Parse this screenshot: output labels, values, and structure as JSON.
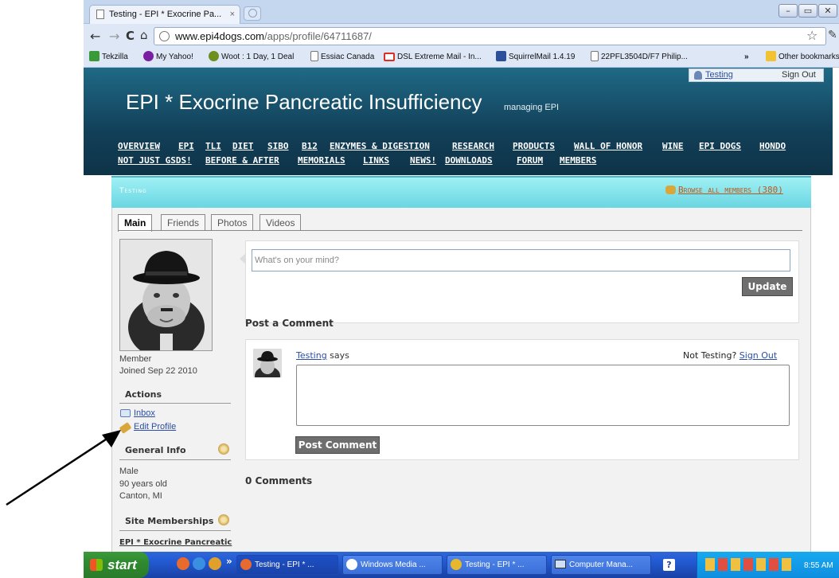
{
  "browser": {
    "tab_title": "Testing - EPI * Exocrine Pa...",
    "tab_close": "×",
    "url_domain": "www.epi4dogs.com",
    "url_path": "/apps/profile/64711687/",
    "bookmarks": [
      {
        "label": "Tekzilla",
        "icon": "tekzilla-icon",
        "color": "#3a9a3a"
      },
      {
        "label": "My Yahoo!",
        "icon": "yahoo-icon",
        "color": "#7b1fa2"
      },
      {
        "label": "Woot : 1 Day, 1 Deal",
        "icon": "woot-icon",
        "color": "#6d8f1f"
      },
      {
        "label": "Essiac Canada",
        "icon": "page-icon",
        "color": "#ffffff"
      },
      {
        "label": "DSL Extreme Mail - In...",
        "icon": "gmail-icon",
        "color": "#d93025"
      },
      {
        "label": "SquirrelMail 1.4.19",
        "icon": "squirrelmail-icon",
        "color": "#2b4f9b"
      },
      {
        "label": "22PFL3504D/F7 Philip...",
        "icon": "page-icon",
        "color": "#ffffff"
      }
    ],
    "bookmarks_overflow": "»",
    "other_bookmarks": "Other bookmarks"
  },
  "site": {
    "title": "EPI * Exocrine Pancreatic Insufficiency",
    "subtitle": "managing EPI",
    "user_link": "Testing",
    "sign_out": "Sign Out",
    "nav_row1": [
      "OVERVIEW",
      "EPI",
      "TLI",
      "DIET",
      "SIBO",
      "B12",
      "ENZYMES & DIGESTION",
      "RESEARCH",
      "PRODUCTS",
      "WALL OF HONOR",
      "WINE",
      "EPI DOGS",
      "HONDO"
    ],
    "nav_row2": [
      "NOT JUST GSDS!",
      "BEFORE & AFTER",
      "MEMORIALS",
      "LINKS",
      "NEWS!",
      "DOWNLOADS",
      "FORUM",
      "MEMBERS"
    ]
  },
  "profile": {
    "name_header": "Testing",
    "browse_all": "Browse all members (380)",
    "tabs": [
      "Main",
      "Friends",
      "Photos",
      "Videos"
    ],
    "member_label": "Member",
    "joined": "Joined Sep 22 2010",
    "actions_header": "Actions",
    "inbox": "Inbox",
    "edit_profile": "Edit Profile",
    "general_info_header": "General Info",
    "gender": "Male",
    "age": "90 years old",
    "location": "Canton, MI",
    "site_memberships_header": "Site Memberships",
    "membership_link": "EPI * Exocrine Pancreatic",
    "status_placeholder": "What's on your mind?",
    "update_button": "Update",
    "post_comment_header": "Post a Comment",
    "commenter_name": "Testing",
    "says": "says",
    "not_user": "Not Testing?",
    "sign_out_link": "Sign Out",
    "post_comment_button": "Post Comment",
    "comments_count": "0 Comments"
  },
  "taskbar": {
    "start": "start",
    "overflow": "»",
    "items": [
      "Testing - EPI * ...",
      "Windows Media ...",
      "Testing - EPI * ...",
      "Computer Mana..."
    ],
    "clock": "8:55 AM"
  }
}
